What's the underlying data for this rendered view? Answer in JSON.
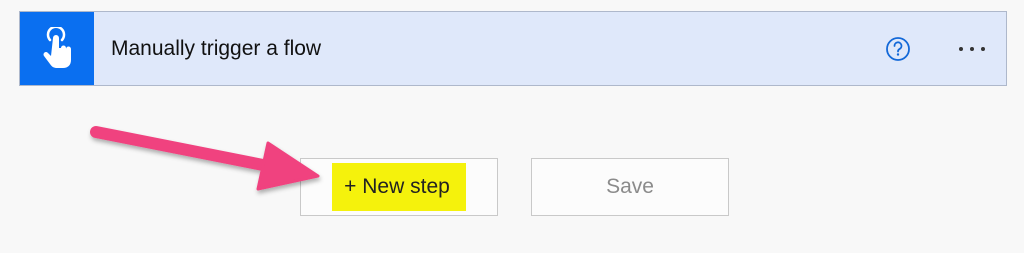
{
  "trigger": {
    "title": "Manually trigger a flow",
    "icon": "touch-hand-icon",
    "help_icon": "question-circle-icon",
    "more_icon": "ellipsis-icon",
    "accent_color": "#0a6ff0",
    "card_background": "#dfe8fa"
  },
  "actions": {
    "new_step_label": "+ New step",
    "save_label": "Save",
    "highlight_color": "#f5f20c"
  },
  "annotation": {
    "arrow_color": "#f0427f"
  }
}
